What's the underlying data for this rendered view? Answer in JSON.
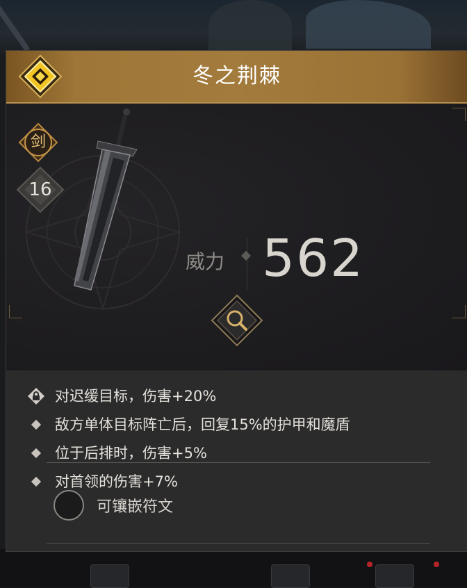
{
  "header": {
    "title": "冬之荆棘"
  },
  "item": {
    "type_label": "剑",
    "level": "16",
    "power_label": "威力",
    "power_value": "562"
  },
  "effects": [
    {
      "text": "对迟缓目标，伤害+20%",
      "icon": "lock-icon"
    },
    {
      "text": "敌方单体目标阵亡后，回复15%的护甲和魔盾",
      "icon": "diamond-bullet"
    },
    {
      "text": "位于后排时，伤害+5%",
      "icon": "diamond-bullet"
    },
    {
      "text": "对首领的伤害+7%",
      "icon": "diamond-bullet"
    }
  ],
  "socket": {
    "label": "可镶嵌符文"
  },
  "colors": {
    "accent_gold": "#a37b3c",
    "panel": "#2b2b2c"
  }
}
